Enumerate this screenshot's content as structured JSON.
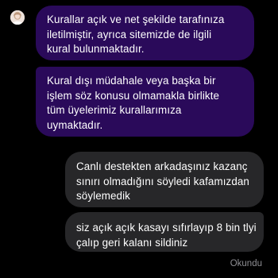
{
  "conversation": {
    "incoming": [
      {
        "lines": [
          "Kurallar açık ve net şekilde tarafınıza",
          "iletilmiştir, ayrıca sitemizde de ilgili",
          "kural bulunmaktadır."
        ]
      },
      {
        "lines": [
          "Kural dışı müdahale veya başka bir",
          "işlem söz konusu olmamakla birlikte",
          "tüm üyelerimiz kurallarımıza",
          "uymaktadır."
        ]
      }
    ],
    "outgoing": [
      {
        "lines": [
          "Canlı destekten arkadaşınız kazanç",
          "sınırı olmadığını söyledi kafamızdan",
          "söylemedik"
        ]
      },
      {
        "lines": [
          "siz açık açık kasayı sıfırlayıp 8 bin tlyi",
          "çalıp geri kalanı sildiniz"
        ]
      }
    ],
    "seen_status": "Okundu"
  },
  "colors": {
    "background": "#000000",
    "incoming_bubble": "#2a0a5a",
    "outgoing_bubble": "#272729",
    "text": "#ffffff",
    "seen_text": "#8e8e93"
  },
  "icons": {
    "avatar": "profile-avatar-icon"
  }
}
